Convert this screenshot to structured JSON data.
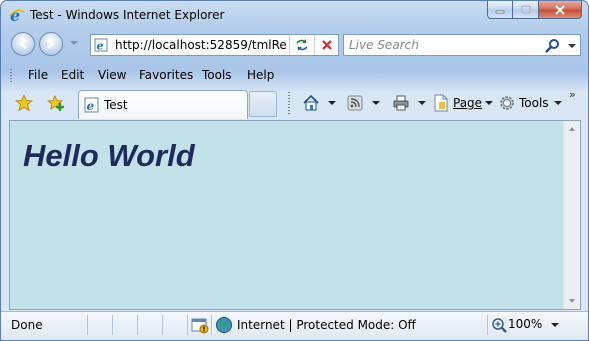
{
  "window": {
    "title": "Test - Windows Internet Explorer"
  },
  "nav": {
    "address": "http://localhost:52859/tmlRe",
    "search_placeholder": "Live Search"
  },
  "menu": {
    "items": [
      "File",
      "Edit",
      "View",
      "Favorites",
      "Tools",
      "Help"
    ]
  },
  "tabs": [
    {
      "label": "Test"
    }
  ],
  "toolbar": {
    "page_label": "Page",
    "tools_label": "Tools",
    "overflow": "»"
  },
  "content": {
    "heading": "Hello World"
  },
  "status": {
    "left_text": "Done",
    "zone_text": "Internet | Protected Mode: Off",
    "zoom": "100%"
  },
  "colors": {
    "content_bg": "#c3e1e8",
    "heading": "#1f2a5c",
    "ie_blue": "#1e73c8"
  }
}
